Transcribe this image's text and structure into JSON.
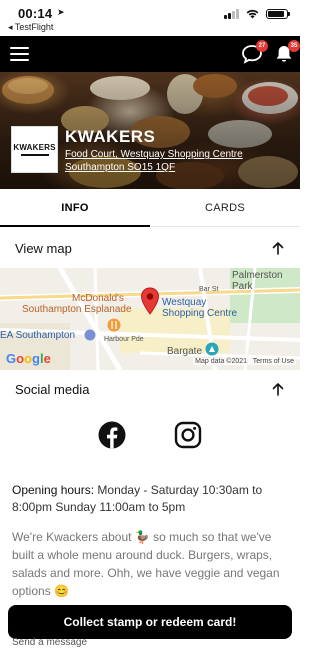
{
  "status_bar": {
    "time": "00:14",
    "back_app": "◂ TestFlight"
  },
  "top_bar": {
    "chat_badge": "27",
    "notification_badge": "35"
  },
  "hero": {
    "logo_text": "KWAKERS",
    "name": "KWAKERS",
    "address": "Food Court, Westquay Shopping Centre Southampton SO15 1QF"
  },
  "tabs": [
    {
      "label": "INFO",
      "active": true
    },
    {
      "label": "CARDS",
      "active": false
    }
  ],
  "view_map": {
    "label": "View map"
  },
  "map": {
    "labels": {
      "mcdonalds": "McDonald's",
      "esplanade": "Southampton Esplanade",
      "westquay": "Westquay Shopping Centre",
      "park": "Palmerston Park",
      "ea": "EA Southampton",
      "bargate": "Bargate",
      "harbour_pde": "Harbour Pde",
      "bar_st": "Bar St"
    },
    "credit": "Map data ©2021",
    "terms": "Terms of Use"
  },
  "social_media": {
    "label": "Social media"
  },
  "opening_hours": {
    "label": "Opening hours:",
    "value": "Monday - Saturday 10:30am to 8:00pm Sunday 11:00am to 5pm"
  },
  "about": "We're Kwackers about 🦆 so much so that we've built a whole menu around duck. Burgers, wraps, salads and more. Ohh, we have veggie and vegan options 😊",
  "cta": {
    "label": "Collect stamp or redeem card!"
  },
  "send_message": "Send a message",
  "colors": {
    "topbar": "#000000",
    "badge": "#e53935",
    "map_pin": "#e53935",
    "facebook": "#111111"
  }
}
